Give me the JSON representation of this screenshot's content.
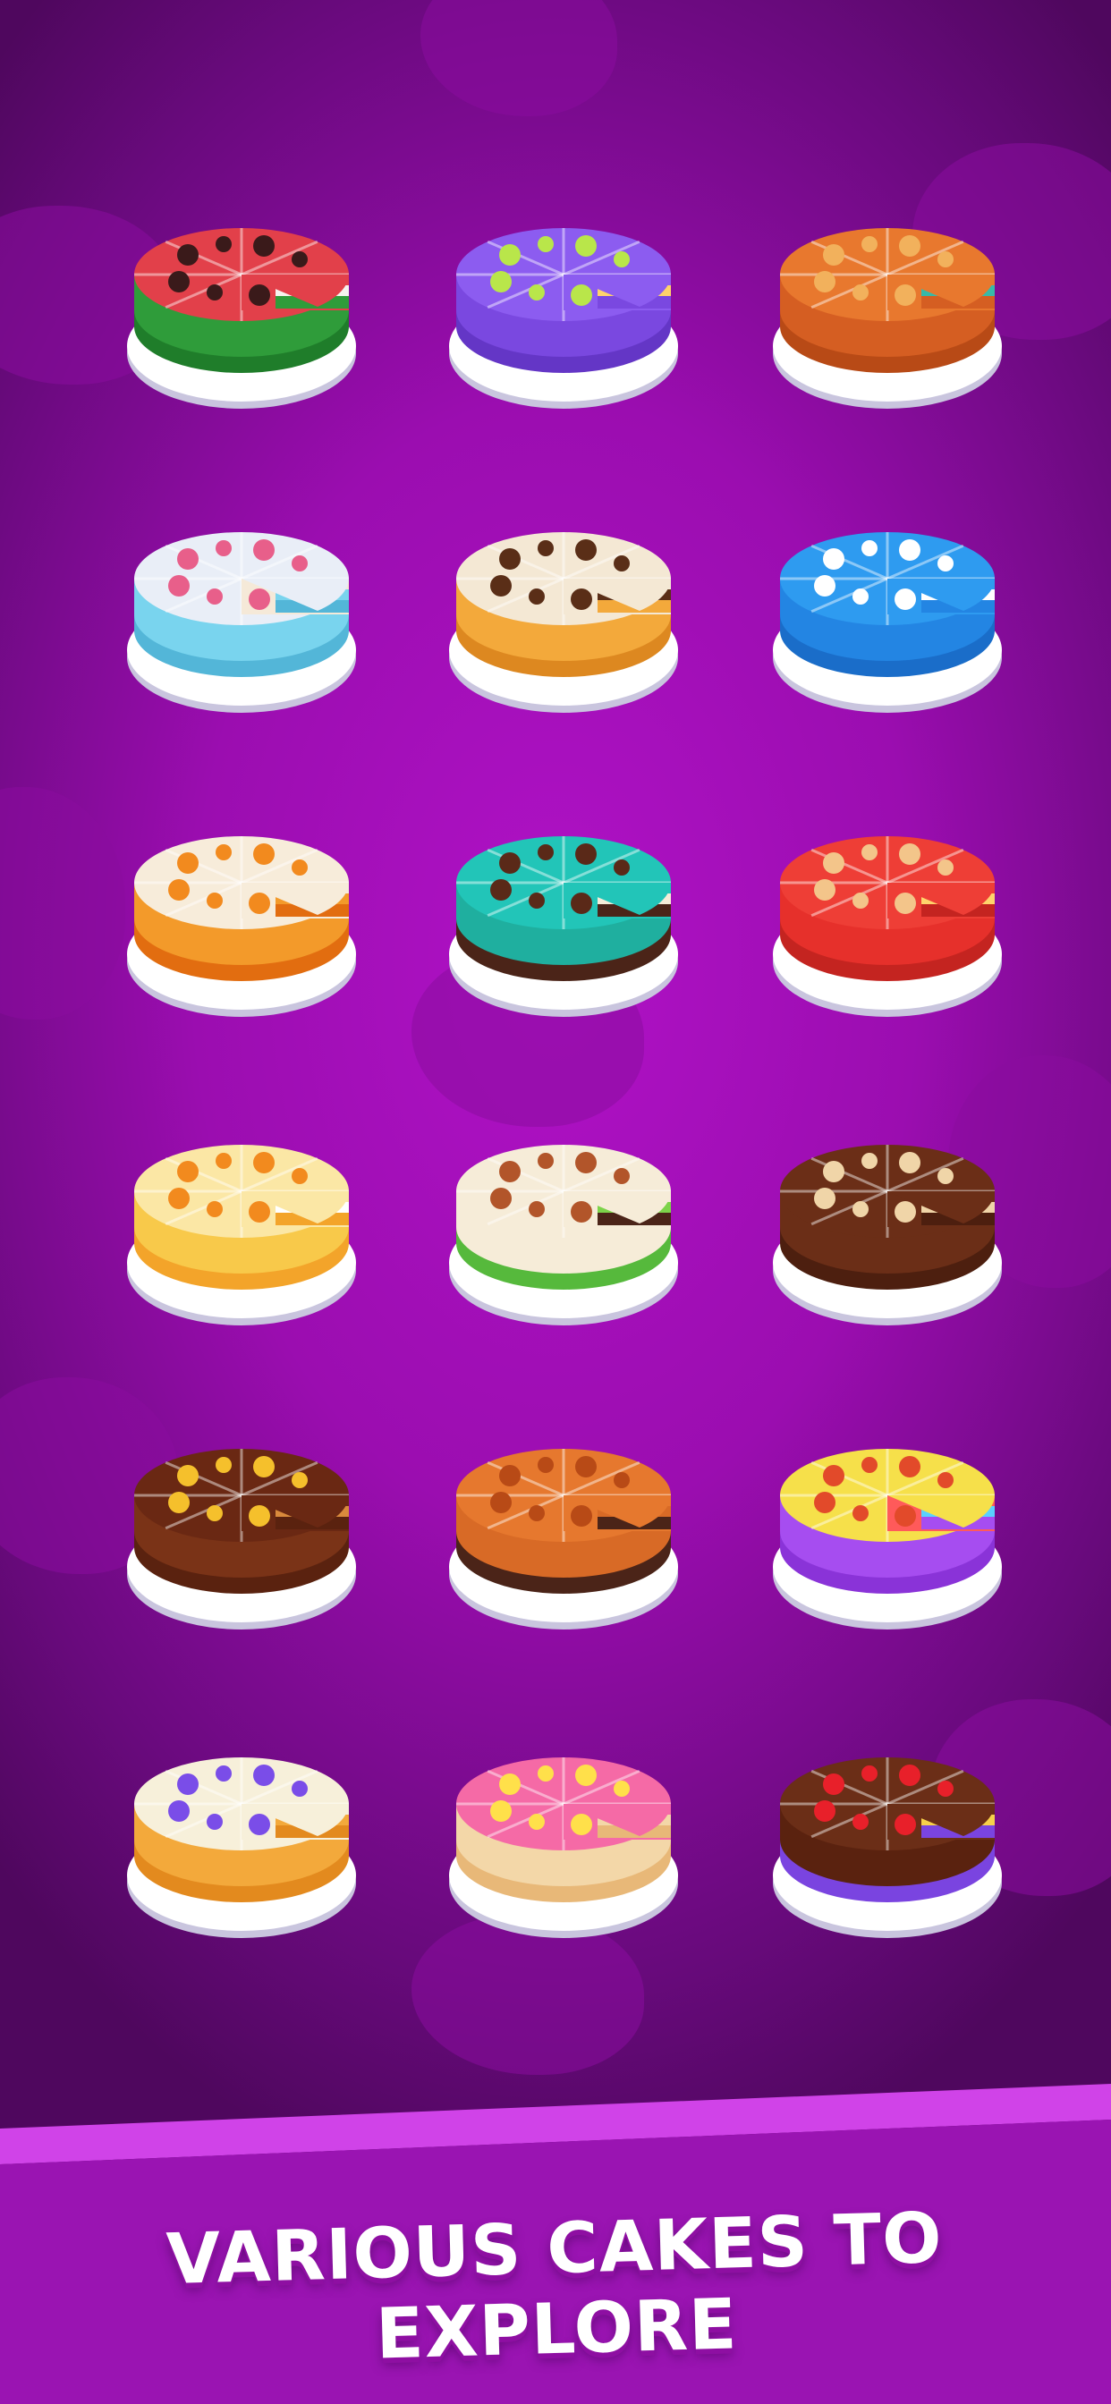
{
  "banner": {
    "text": "VARIOUS CAKES TO EXPLORE",
    "stripe_color": "#d043e8",
    "band_color": "#9a14b2"
  },
  "background": {
    "top_color": "#b012c6",
    "bottom_color": "#4f075e"
  },
  "cakes": [
    {
      "name": "watermelon",
      "top": "#e2404a",
      "side": "#2f9c3a",
      "side2": "#1f7d2a",
      "accent": "#3a1a1a",
      "layers": [
        "#e2404a",
        "#f6f3ee",
        "#2f9c3a"
      ]
    },
    {
      "name": "lime-purple",
      "top": "#8c5cf0",
      "side": "#7a48e0",
      "side2": "#6436c6",
      "accent": "#b9e64a",
      "layers": [
        "#8c5cf0",
        "#ffd36b",
        "#7a48e0"
      ]
    },
    {
      "name": "caramel-nut",
      "top": "#e8782e",
      "side": "#d55e22",
      "side2": "#b84a16",
      "accent": "#f2b15c",
      "layers": [
        "#e8782e",
        "#37b9a8",
        "#d55e22"
      ]
    },
    {
      "name": "blue-flower",
      "top": "#e9eef7",
      "side": "#79d4ee",
      "side2": "#53b6d8",
      "accent": "#e85f8a",
      "layers": [
        "#f5e9d8",
        "#79d4ee",
        "#53b6d8"
      ]
    },
    {
      "name": "chocolate-swirl",
      "top": "#f4e8d4",
      "side": "#f3a93b",
      "side2": "#dd8820",
      "accent": "#5a2e17",
      "layers": [
        "#f4e8d4",
        "#5a2e17",
        "#f3a93b"
      ]
    },
    {
      "name": "blue-cream",
      "top": "#2e9bf0",
      "side": "#2385e3",
      "side2": "#1a6dc9",
      "accent": "#ffffff",
      "layers": [
        "#2e9bf0",
        "#ffffff",
        "#2385e3"
      ]
    },
    {
      "name": "orange-cream",
      "top": "#f7ecda",
      "side": "#f39a2a",
      "side2": "#e26d10",
      "accent": "#f28a1e",
      "layers": [
        "#f7ecda",
        "#f39a2a",
        "#e26d10"
      ]
    },
    {
      "name": "teal-choc",
      "top": "#22c5b8",
      "side": "#1faf9f",
      "side2": "#4b2418",
      "accent": "#5a2918",
      "layers": [
        "#22c5b8",
        "#f6ecd8",
        "#4b2418"
      ]
    },
    {
      "name": "red-almond",
      "top": "#ee3e36",
      "side": "#e6302b",
      "side2": "#c42420",
      "accent": "#f3c58a",
      "layers": [
        "#ee3e36",
        "#ffd36b",
        "#c42420"
      ]
    },
    {
      "name": "yellow-orange",
      "top": "#fbe7a5",
      "side": "#f8c94a",
      "side2": "#f3a42a",
      "accent": "#f28a1e",
      "layers": [
        "#fbe7a5",
        "#ffffff",
        "#f3a42a"
      ]
    },
    {
      "name": "cream-green",
      "top": "#f6ecd8",
      "side": "#f6ecd8",
      "side2": "#56b93c",
      "accent": "#b2552a",
      "layers": [
        "#f6ecd8",
        "#7cd34a",
        "#4b2418"
      ]
    },
    {
      "name": "choc-cream-puff",
      "top": "#6b2e17",
      "side": "#6b2e17",
      "side2": "#4d1f0f",
      "accent": "#f0d5a8",
      "layers": [
        "#6b2e17",
        "#f0d5a8",
        "#4d1f0f"
      ]
    },
    {
      "name": "choc-sprinkle",
      "top": "#6a2813",
      "side": "#7a3317",
      "side2": "#5a220f",
      "accent": "#f5c02c",
      "layers": [
        "#6a2813",
        "#d98a3c",
        "#5a220f"
      ]
    },
    {
      "name": "heart-caramel",
      "top": "#e6782e",
      "side": "#d86a26",
      "side2": "#4b2418",
      "accent": "#b84a16",
      "layers": [
        "#e6782e",
        "#d86a26",
        "#4b2418"
      ]
    },
    {
      "name": "rainbow",
      "top": "#f6e04a",
      "side": "#a64df0",
      "side2": "#8a33d8",
      "accent": "#e24a2a",
      "layers": [
        "#ff5a5a",
        "#5ad0ff",
        "#a64df0"
      ]
    },
    {
      "name": "blueberry-cream",
      "top": "#f7f0da",
      "side": "#f3a93b",
      "side2": "#e38a1e",
      "accent": "#7a4de8",
      "layers": [
        "#f7f0da",
        "#f3a93b",
        "#e38a1e"
      ]
    },
    {
      "name": "pink-donut",
      "top": "#f56aa6",
      "side": "#f3d7a8",
      "side2": "#e8b878",
      "accent": "#ffe04a",
      "layers": [
        "#f56aa6",
        "#f3d7a8",
        "#e8b878"
      ]
    },
    {
      "name": "choc-cherry",
      "top": "#6b2e17",
      "side": "#5a220f",
      "side2": "#7a44e0",
      "accent": "#e8202a",
      "layers": [
        "#6b2e17",
        "#f6d04a",
        "#7a44e0"
      ]
    }
  ]
}
